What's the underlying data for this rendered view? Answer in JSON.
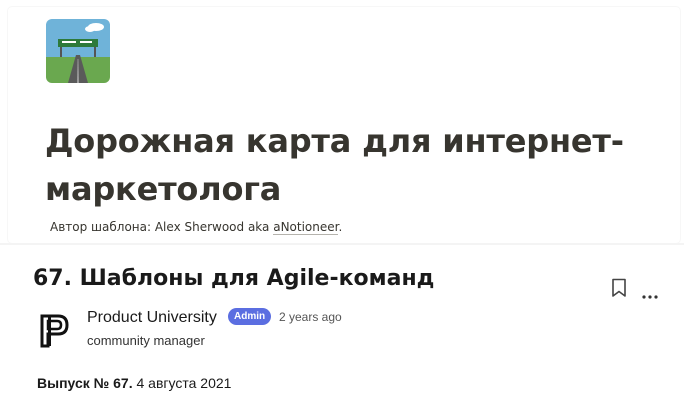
{
  "embed": {
    "icon": "roadmap-highway-icon",
    "title": "Дорожная карта для интернет-маркетолога",
    "author_prefix": "Автор шаблона: Alex Sherwood aka ",
    "author_link": "aNotioneer",
    "author_suffix": "."
  },
  "post": {
    "title": "67. Шаблоны для Agile-команд",
    "author_name": "Product University",
    "badge": "Admin",
    "time": "2 years ago",
    "role": "community manager",
    "issue_label": "Выпуск № 67.",
    "issue_date": " 4 августа 2021",
    "bookmark_icon": "bookmark-icon",
    "more_icon": "more-options-icon"
  },
  "colors": {
    "badge": "#5b6ee1",
    "title_text": "#37352f"
  }
}
